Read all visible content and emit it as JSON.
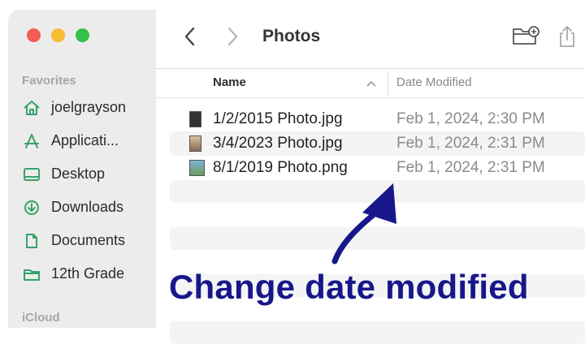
{
  "window": {
    "title": "Photos"
  },
  "sidebar": {
    "favorites_title": "Favorites",
    "icloud_title": "iCloud",
    "items": [
      {
        "label": "joelgrayson",
        "icon": "home-icon"
      },
      {
        "label": "Applicati...",
        "icon": "applications-icon"
      },
      {
        "label": "Desktop",
        "icon": "desktop-icon"
      },
      {
        "label": "Downloads",
        "icon": "downloads-icon"
      },
      {
        "label": "Documents",
        "icon": "document-icon"
      },
      {
        "label": "12th Grade",
        "icon": "folder-icon"
      }
    ]
  },
  "columns": {
    "name": "Name",
    "date_modified": "Date Modified"
  },
  "files": [
    {
      "name": "1/2/2015 Photo.jpg",
      "date": "Feb 1, 2024, 2:30 PM"
    },
    {
      "name": "3/4/2023 Photo.jpg",
      "date": "Feb 1, 2024, 2:31 PM"
    },
    {
      "name": "8/1/2019 Photo.png",
      "date": "Feb 1, 2024, 2:31 PM"
    }
  ],
  "annotation": {
    "text": "Change date modified",
    "color": "#17178b"
  },
  "colors": {
    "accent": "#33a36b",
    "sidebar_bg": "#ececec"
  }
}
